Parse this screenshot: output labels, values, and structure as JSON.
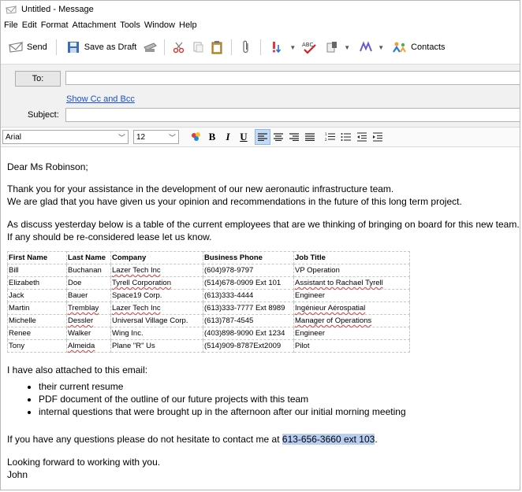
{
  "window": {
    "title": "Untitled - Message"
  },
  "menu": [
    "File",
    "Edit",
    "Format",
    "Attachment",
    "Tools",
    "Window",
    "Help"
  ],
  "toolbar": {
    "send_label": "Send",
    "save_draft_label": "Save as Draft",
    "contacts_label": "Contacts"
  },
  "header": {
    "to_label": "To:",
    "to_value": "",
    "show_cc_bcc": "Show Cc and Bcc",
    "subject_label": "Subject:",
    "subject_value": ""
  },
  "format": {
    "font": "Arial",
    "size": "12",
    "bold": "B",
    "italic": "I",
    "underline": "U"
  },
  "body": {
    "greeting": "Dear Ms Robinson;",
    "para1_line1": "Thank you for your assistance in the development of our new aeronautic infrastructure team.",
    "para1_line2": "We are glad that you have given us your opinion and recommendations in the future of this long term project.",
    "para2_line1": "As discuss yesterday below is a table of the current employees that are we thinking of bringing on board for this new team.",
    "para2_line2": "If any should be re-considered lease let us know.",
    "table": {
      "headers": [
        "First Name",
        "Last Name",
        "Company",
        "Business Phone",
        "Job Title"
      ],
      "rows": [
        [
          "Bill",
          "Buchanan",
          "Lazer Tech Inc",
          "(604)978-9797",
          "VP Operation"
        ],
        [
          "Elizabeth",
          "Doe",
          "Tyrell Corporation",
          "(514)678-0909 Ext 101",
          "Assistant to Rachael Tyrell"
        ],
        [
          "Jack",
          "Bauer",
          "Space19 Corp.",
          "(613)333-4444",
          "Engineer"
        ],
        [
          "Martin",
          "Tremblay",
          "Lazer Tech Inc",
          "(613)333-7777 Ext 8989",
          "Ingénieur Aérospatial"
        ],
        [
          "Michelle",
          "Dessler",
          "Universal Village Corp.",
          "(613)787-4545",
          "Manager of Operations"
        ],
        [
          "Renee",
          "Walker",
          "Wing Inc.",
          "(403)898-9090 Ext 1234",
          "Engineer"
        ],
        [
          "Tony",
          "Almeida",
          "Plane \"R\" Us",
          "(514)909-8787Ext2009",
          "Pilot"
        ]
      ]
    },
    "attached_intro": "I have also attached to this email:",
    "attachments": [
      "their current resume",
      "PDF document of the outline of our future projects with this team",
      "internal questions that were brought up in the afternoon after our initial morning meeting"
    ],
    "contact_prefix": "If you have any questions please do not hesitate to contact me at ",
    "contact_phone": "613-656-3660 ext 103",
    "contact_suffix": ".",
    "closing": "Looking forward to working with you.",
    "signature": "John"
  }
}
